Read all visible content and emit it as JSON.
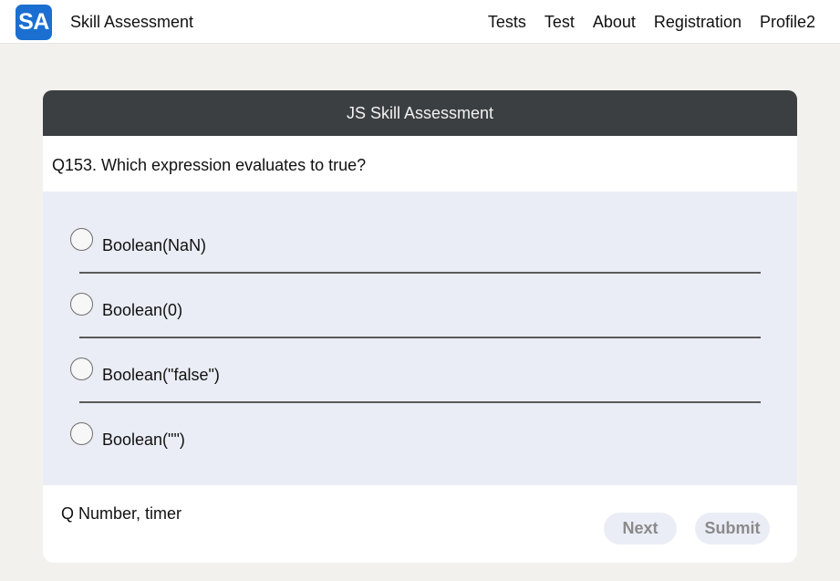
{
  "navbar": {
    "logo_text": "SA",
    "brand": "Skill Assessment",
    "links": [
      "Tests",
      "Test",
      "About",
      "Registration",
      "Profile2"
    ]
  },
  "card": {
    "title": "JS Skill Assessment",
    "question": "Q153. Which expression evaluates to true?",
    "options": [
      "Boolean(NaN)",
      "Boolean(0)",
      "Boolean(\"false\")",
      "Boolean(\"\")"
    ],
    "footer_text": "Q Number, timer",
    "next_label": "Next",
    "submit_label": "Submit"
  },
  "colors": {
    "accent": "#1b6fd1",
    "header_bg": "#3c3f41",
    "options_bg": "#eaedf5",
    "page_bg": "#f2f1ee"
  }
}
